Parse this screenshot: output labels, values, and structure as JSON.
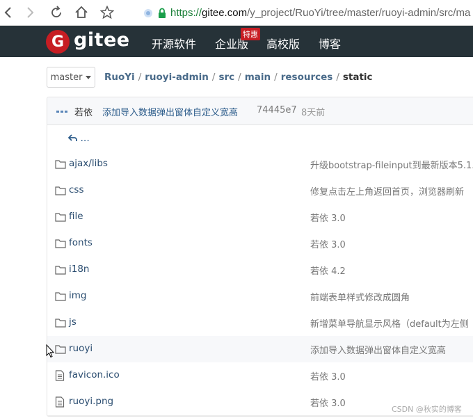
{
  "browser": {
    "url_scheme": "https://",
    "url_host": "gitee.com",
    "url_path": "/y_project/RuoYi/tree/master/ruoyi-admin/src/ma"
  },
  "header": {
    "logo_glyph": "G",
    "logo_text": "gitee",
    "nav": [
      "开源软件",
      "企业版",
      "高校版",
      "博客"
    ],
    "badge": "特惠",
    "brand_color": "#c71d23"
  },
  "branch": {
    "label": "master"
  },
  "breadcrumb": {
    "items": [
      "RuoYi",
      "ruoyi-admin",
      "src",
      "main",
      "resources"
    ],
    "current": "static"
  },
  "commit": {
    "author": "若依",
    "message": "添加导入数据弹出窗体自定义宽高",
    "sha": "74445e7",
    "time": "8天前"
  },
  "parent": {
    "label": "..."
  },
  "files": [
    {
      "type": "folder",
      "name": "ajax/libs",
      "message": "升级bootstrap-fileinput到最新版本5.1."
    },
    {
      "type": "folder",
      "name": "css",
      "message": "修复点击左上角返回首页，浏览器刷新"
    },
    {
      "type": "folder",
      "name": "file",
      "message": "若依 3.0"
    },
    {
      "type": "folder",
      "name": "fonts",
      "message": "若依 3.0"
    },
    {
      "type": "folder",
      "name": "i18n",
      "message": "若依 4.2"
    },
    {
      "type": "folder",
      "name": "img",
      "message": "前端表单样式修改成圆角"
    },
    {
      "type": "folder",
      "name": "js",
      "message": "新增菜单导航显示风格（default为左侧"
    },
    {
      "type": "folder",
      "name": "ruoyi",
      "message": "添加导入数据弹出窗体自定义宽高"
    },
    {
      "type": "file",
      "name": "favicon.ico",
      "message": "若依 3.0"
    },
    {
      "type": "file",
      "name": "ruoyi.png",
      "message": "若依 3.0"
    }
  ],
  "watermark": "CSDN @秋实的博客"
}
